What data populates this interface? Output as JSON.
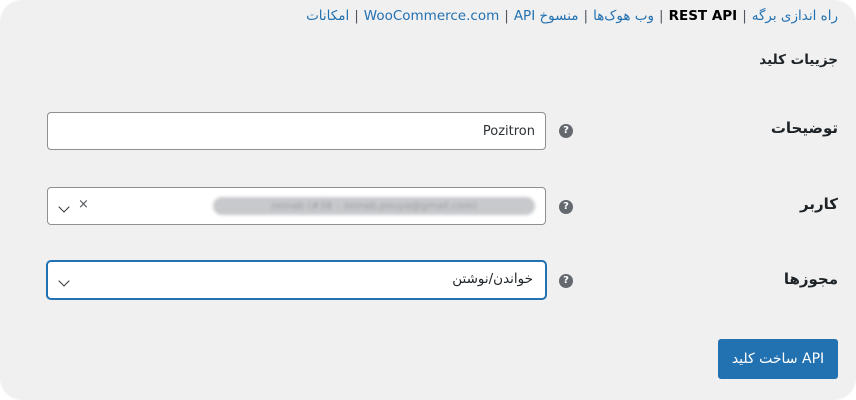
{
  "subnav": {
    "items": [
      {
        "label": "راه اندازی برگه",
        "current": false
      },
      {
        "label": "REST API",
        "current": true
      },
      {
        "label": "وب هوک‌ها",
        "current": false
      },
      {
        "label": "API منسوخ",
        "current": false
      },
      {
        "label": "WooCommerce.com",
        "current": false
      },
      {
        "label": "امکانات",
        "current": false
      }
    ],
    "separator": "|"
  },
  "section_title": "جزییات کلید",
  "form": {
    "description": {
      "label": "توضیحات",
      "value": "Pozitron",
      "help": "?"
    },
    "user": {
      "label": "کاربر",
      "value": "zeinab (#38 – zeinab.pouya@gmail.com)",
      "clear": "×",
      "help": "?"
    },
    "permissions": {
      "label": "مجوزها",
      "value": "خواندن/نوشتن",
      "help": "?"
    }
  },
  "submit_label": "ساخت کلید API",
  "colors": {
    "link": "#2271b1",
    "primary_button": "#2271b1",
    "background": "#f0f0f1"
  }
}
